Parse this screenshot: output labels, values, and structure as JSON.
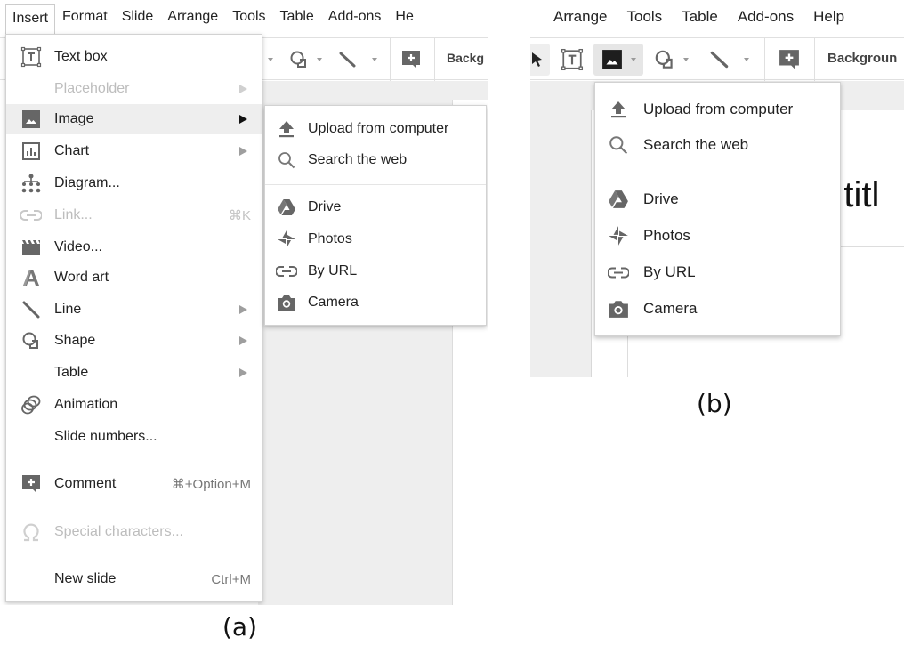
{
  "panel_a": {
    "menubar": [
      "Insert",
      "Format",
      "Slide",
      "Arrange",
      "Tools",
      "Table",
      "Add-ons",
      "He"
    ],
    "toolbar": {
      "background_label": "Backg"
    },
    "insert_menu": [
      {
        "label": "Text box",
        "icon": "text-box-icon",
        "state": "normal",
        "shortcut": "",
        "submenu": false
      },
      {
        "label": "Placeholder",
        "icon": "",
        "state": "disabled",
        "shortcut": "",
        "submenu": true
      },
      {
        "label": "Image",
        "icon": "image-icon",
        "state": "highlighted",
        "shortcut": "",
        "submenu": true
      },
      {
        "label": "Chart",
        "icon": "chart-icon",
        "state": "normal",
        "shortcut": "",
        "submenu": true
      },
      {
        "label": "Diagram...",
        "icon": "diagram-icon",
        "state": "normal",
        "shortcut": "",
        "submenu": false
      },
      {
        "label": "Link...",
        "icon": "link-icon",
        "state": "disabled",
        "shortcut": "⌘K",
        "submenu": false
      },
      {
        "label": "Video...",
        "icon": "video-icon",
        "state": "normal",
        "shortcut": "",
        "submenu": false
      },
      {
        "label": "Word art",
        "icon": "word-art-icon",
        "state": "normal",
        "shortcut": "",
        "submenu": false
      },
      {
        "label": "Line",
        "icon": "line-icon",
        "state": "normal",
        "shortcut": "",
        "submenu": true
      },
      {
        "label": "Shape",
        "icon": "shape-icon",
        "state": "normal",
        "shortcut": "",
        "submenu": true
      },
      {
        "label": "Table",
        "icon": "",
        "state": "normal",
        "shortcut": "",
        "submenu": true
      },
      {
        "label": "Animation",
        "icon": "animation-icon",
        "state": "normal",
        "shortcut": "",
        "submenu": false
      },
      {
        "label": "Slide numbers...",
        "icon": "",
        "state": "normal",
        "shortcut": "",
        "submenu": false
      },
      {
        "label": "Comment",
        "icon": "comment-icon",
        "state": "normal",
        "shortcut": "⌘+Option+M",
        "submenu": false
      },
      {
        "label": "Special characters...",
        "icon": "omega-icon",
        "state": "disabled",
        "shortcut": "",
        "submenu": false
      },
      {
        "label": "New slide",
        "icon": "",
        "state": "normal",
        "shortcut": "Ctrl+M",
        "submenu": false
      }
    ],
    "image_submenu": [
      {
        "label": "Upload from computer",
        "icon": "upload-icon"
      },
      {
        "label": "Search the web",
        "icon": "search-icon"
      },
      {
        "label": "Drive",
        "icon": "drive-icon"
      },
      {
        "label": "Photos",
        "icon": "photos-icon"
      },
      {
        "label": "By URL",
        "icon": "link-icon"
      },
      {
        "label": "Camera",
        "icon": "camera-icon"
      }
    ],
    "caption": "(a)"
  },
  "panel_b": {
    "menubar": [
      "Arrange",
      "Tools",
      "Table",
      "Add-ons",
      "Help"
    ],
    "toolbar": {
      "background_label": "Backgroun"
    },
    "image_dropdown": [
      {
        "label": "Upload from computer",
        "icon": "upload-icon"
      },
      {
        "label": "Search the web",
        "icon": "search-icon"
      },
      {
        "label": "Drive",
        "icon": "drive-icon"
      },
      {
        "label": "Photos",
        "icon": "photos-icon"
      },
      {
        "label": "By URL",
        "icon": "link-icon"
      },
      {
        "label": "Camera",
        "icon": "camera-icon"
      }
    ],
    "slide_title_fragment": "d titl",
    "caption": "(b)"
  },
  "colors": {
    "icon_gray": "#757575",
    "disabled_text": "#bdbdbd",
    "highlight_bg": "#eeeeee",
    "canvas_bg": "#eeeeee"
  }
}
